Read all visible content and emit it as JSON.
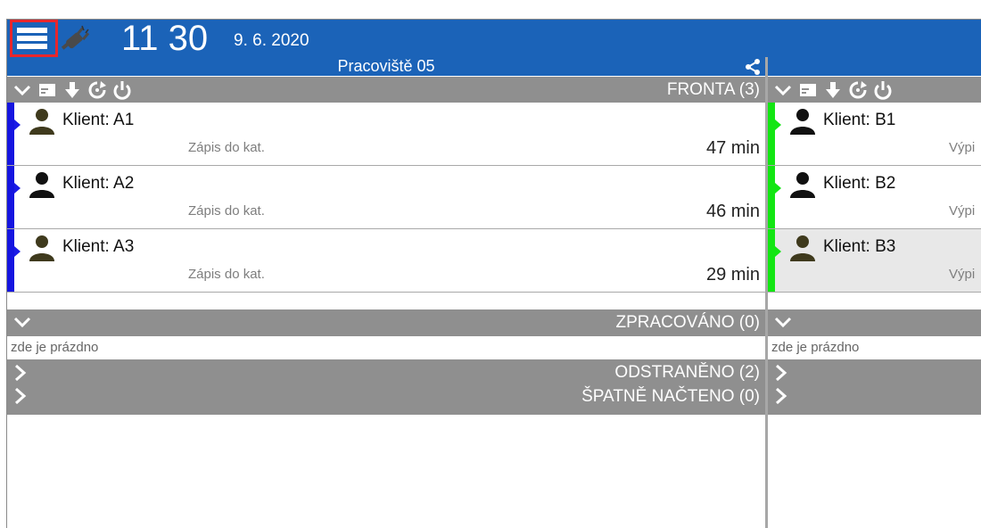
{
  "header": {
    "time_hours": "11",
    "time_minutes": "30",
    "date": "9. 6. 2020",
    "menu_icon": "hamburger-menu-icon",
    "plug_icon": "disconnected-plug-icon",
    "accent_color": "#1b63b8"
  },
  "workstations": [
    {
      "title": "Pracoviště 05",
      "queue_label": "FRONTA (3)",
      "processed_label": "ZPRACOVÁNO (0)",
      "processed_empty": "zde je prázdno",
      "removed_label": "ODSTRANĚNO (2)",
      "badload_label": "ŠPATNĚ NAČTENO (0)",
      "stripe_color": "#1515e0",
      "clients": [
        {
          "name": "Klient: A1",
          "task": "Zápis do kat.",
          "time": "47 min"
        },
        {
          "name": "Klient: A2",
          "task": "Zápis do kat.",
          "time": "46 min"
        },
        {
          "name": "Klient: A3",
          "task": "Zápis do kat.",
          "time": "29 min"
        }
      ]
    },
    {
      "processed_empty": "zde je prázdno",
      "stripe_color": "#13e613",
      "clients": [
        {
          "name": "Klient: B1",
          "task": "Výpi"
        },
        {
          "name": "Klient: B2",
          "task": "Výpi"
        },
        {
          "name": "Klient: B3",
          "task": "Výpi",
          "selected": true
        }
      ]
    }
  ]
}
